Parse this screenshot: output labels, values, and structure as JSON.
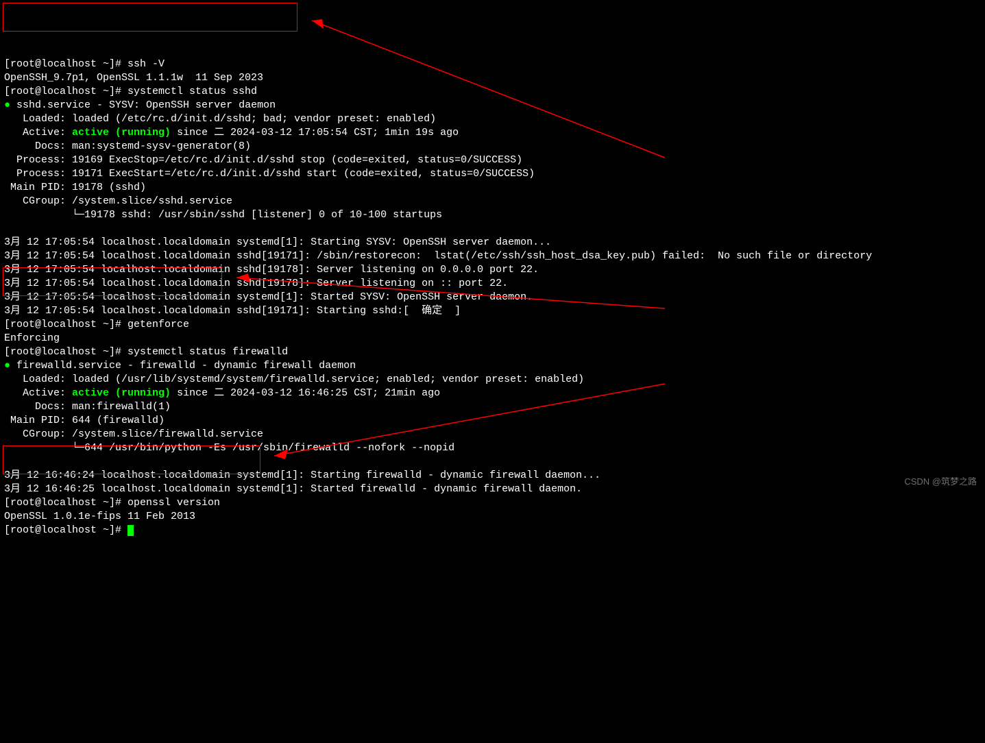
{
  "lines": {
    "l1": "[root@localhost ~]# ssh -V",
    "l2": "OpenSSH_9.7p1, OpenSSL 1.1.1w  11 Sep 2023",
    "l3": "[root@localhost ~]# systemctl status sshd",
    "l4a": "● ",
    "l4b": "sshd.service - SYSV: OpenSSH server daemon",
    "l5": "   Loaded: loaded (/etc/rc.d/init.d/sshd; bad; vendor preset: enabled)",
    "l6a": "   Active: ",
    "l6b": "active (running)",
    "l6c": " since 二 2024-03-12 17:05:54 CST; 1min 19s ago",
    "l7": "     Docs: man:systemd-sysv-generator(8)",
    "l8": "  Process: 19169 ExecStop=/etc/rc.d/init.d/sshd stop (code=exited, status=0/SUCCESS)",
    "l9": "  Process: 19171 ExecStart=/etc/rc.d/init.d/sshd start (code=exited, status=0/SUCCESS)",
    "l10": " Main PID: 19178 (sshd)",
    "l11": "   CGroup: /system.slice/sshd.service",
    "l12": "           └─19178 sshd: /usr/sbin/sshd [listener] 0 of 10-100 startups",
    "blank1": "",
    "l13": "3月 12 17:05:54 localhost.localdomain systemd[1]: Starting SYSV: OpenSSH server daemon...",
    "l14": "3月 12 17:05:54 localhost.localdomain sshd[19171]: /sbin/restorecon:  lstat(/etc/ssh/ssh_host_dsa_key.pub) failed:  No such file or directory",
    "l15": "3月 12 17:05:54 localhost.localdomain sshd[19178]: Server listening on 0.0.0.0 port 22.",
    "l16": "3月 12 17:05:54 localhost.localdomain sshd[19178]: Server listening on :: port 22.",
    "l17": "3月 12 17:05:54 localhost.localdomain systemd[1]: Started SYSV: OpenSSH server daemon.",
    "l18": "3月 12 17:05:54 localhost.localdomain sshd[19171]: Starting sshd:[  确定  ]",
    "l19": "[root@localhost ~]# getenforce",
    "l20": "Enforcing",
    "l21": "[root@localhost ~]# systemctl status firewalld",
    "l22a": "● ",
    "l22b": "firewalld.service - firewalld - dynamic firewall daemon",
    "l23": "   Loaded: loaded (/usr/lib/systemd/system/firewalld.service; enabled; vendor preset: enabled)",
    "l24a": "   Active: ",
    "l24b": "active (running)",
    "l24c": " since 二 2024-03-12 16:46:25 CST; 21min ago",
    "l25": "     Docs: man:firewalld(1)",
    "l26": " Main PID: 644 (firewalld)",
    "l27": "   CGroup: /system.slice/firewalld.service",
    "l28": "           └─644 /usr/bin/python -Es /usr/sbin/firewalld --nofork --nopid",
    "blank2": "",
    "l29": "3月 12 16:46:24 localhost.localdomain systemd[1]: Starting firewalld - dynamic firewall daemon...",
    "l30": "3月 12 16:46:25 localhost.localdomain systemd[1]: Started firewalld - dynamic firewall daemon.",
    "l31": "[root@localhost ~]# openssl version",
    "l32": "OpenSSL 1.0.1e-fips 11 Feb 2013",
    "l33": "[root@localhost ~]# "
  },
  "watermark": "CSDN @筑梦之路"
}
